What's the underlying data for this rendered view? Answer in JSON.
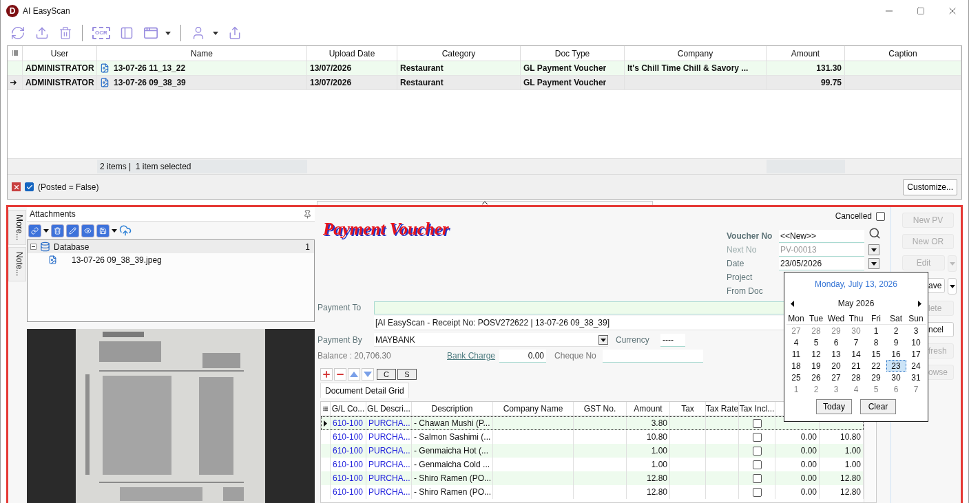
{
  "window": {
    "logo": "D",
    "title": "AI EasyScan"
  },
  "toolbar": {
    "ocr_label": "OCR"
  },
  "list": {
    "columns": [
      "User",
      "Name",
      "Upload Date",
      "Category",
      "Doc Type",
      "Company",
      "Amount",
      "Caption"
    ],
    "rows": [
      {
        "user": "ADMINISTRATOR",
        "name": "13-07-26 11_13_22",
        "upload_date": "13/07/2026",
        "category": "Restaurant",
        "doc_type": "GL Payment Voucher",
        "company": "It's Chill Time Chill & Savory ...",
        "amount": "131.30",
        "selected": false
      },
      {
        "user": "ADMINISTRATOR",
        "name": "13-07-26 09_38_39",
        "upload_date": "13/07/2026",
        "category": "Restaurant",
        "doc_type": "GL Payment Voucher",
        "amount": "99.75",
        "selected": true
      }
    ],
    "footer": "2 items |  1 item selected"
  },
  "filter": {
    "active": true,
    "text": "(Posted = False)",
    "customize_button": "Customize..."
  },
  "side_tabs": [
    "More...",
    "Note..."
  ],
  "attachments": {
    "title": "Attachments",
    "tree": [
      {
        "label": "Database",
        "count": "1",
        "expanded": true,
        "children": [
          {
            "label": "13-07-26 09_38_39.jpeg"
          }
        ]
      }
    ]
  },
  "voucher": {
    "title": "Payment Voucher",
    "cancelled": {
      "label": "Cancelled",
      "checked": false
    },
    "fields": [
      {
        "label": "Voucher No",
        "value": "<<New>>",
        "kind": "search",
        "bold": true,
        "disabled": false
      },
      {
        "label": "Next No",
        "value": "PV-00013",
        "kind": "dropdown",
        "bold": false,
        "disabled": true
      },
      {
        "label": "Date",
        "value": "23/05/2026",
        "kind": "dropdown",
        "bold": false,
        "disabled": false
      },
      {
        "label": "Project",
        "kind": "covered",
        "bold": false,
        "disabled": false
      },
      {
        "label": "From Doc",
        "kind": "covered",
        "bold": false,
        "disabled": false
      }
    ],
    "payment_to": {
      "label": "Payment To",
      "remark": "[AI EasyScan - Receipt No: POSV272622 | 13-07-26 09_38_39]"
    },
    "payment_by": {
      "label": "Payment By",
      "value": "MAYBANK"
    },
    "currency": {
      "label": "Currency",
      "value": "----"
    },
    "balance": "Balance : 20,706.30",
    "bank_charge": {
      "label": "Bank Charge",
      "value": "0.00"
    },
    "cheque_no": {
      "label": "Cheque No"
    },
    "grid_buttons": [
      "C",
      "S"
    ],
    "grid_tab": "Document Detail Grid"
  },
  "detail": {
    "columns": [
      "G/L Co...",
      "GL Descri...",
      "Description",
      "Company Name",
      "GST No.",
      "Amount",
      "Tax",
      "Tax Rate",
      "Tax Incl..."
    ],
    "rows": [
      {
        "gl_code": "610-100",
        "gl_desc": "PURCHA...",
        "description": "- Chawan Mushi (P...",
        "amount": "3.80",
        "tax_inclusive": false,
        "selected": true
      },
      {
        "gl_code": "610-100",
        "gl_desc": "PURCHA...",
        "description": "- Salmon Sashimi (...",
        "amount": "10.80",
        "tax_inclusive": false,
        "column_10": "0.00",
        "column_11": "10.80",
        "selected": false
      },
      {
        "gl_code": "610-100",
        "gl_desc": "PURCHA...",
        "description": "- Genmaicha Hot (...",
        "amount": "1.00",
        "tax_inclusive": false,
        "column_10": "0.00",
        "column_11": "1.00",
        "selected": false
      },
      {
        "gl_code": "610-100",
        "gl_desc": "PURCHA...",
        "description": "- Genmaicha Cold ...",
        "amount": "1.00",
        "tax_inclusive": false,
        "column_10": "0.00",
        "column_11": "1.00",
        "selected": false
      },
      {
        "gl_code": "610-100",
        "gl_desc": "PURCHA...",
        "description": "- Shiro Ramen (PO...",
        "amount": "12.80",
        "tax_inclusive": false,
        "column_10": "0.00",
        "column_11": "12.80",
        "selected": false
      },
      {
        "gl_code": "610-100",
        "gl_desc": "PURCHA...",
        "description": "- Shiro Ramen (PO...",
        "amount": "12.80",
        "tax_inclusive": false,
        "column_10": "0.00",
        "column_11": "12.80",
        "selected": false
      }
    ]
  },
  "buttons": [
    {
      "label": "New PV",
      "disabled": true,
      "dropdown": false,
      "covered": false
    },
    {
      "label": "New OR",
      "disabled": true,
      "dropdown": false,
      "covered": false
    },
    {
      "label": "Edit",
      "disabled": true,
      "dropdown": true,
      "covered": false
    },
    {
      "label": "ave",
      "disabled": false,
      "dropdown": true,
      "covered": true
    },
    {
      "label": "lete",
      "disabled": true,
      "dropdown": false,
      "covered": true
    },
    {
      "label": "ncel",
      "disabled": false,
      "dropdown": false,
      "covered": true
    },
    {
      "label": "fresh",
      "disabled": true,
      "dropdown": false,
      "covered": true
    },
    {
      "label": "owse",
      "disabled": true,
      "dropdown": false,
      "covered": true
    }
  ],
  "calendar": {
    "caption": "Monday, July 13, 2026",
    "month": "May 2026",
    "weekdays": [
      "Mon",
      "Tue",
      "Wed",
      "Thu",
      "Fri",
      "Sat",
      "Sun"
    ],
    "days": [
      {
        "label": "27",
        "outside": true,
        "selected": false
      },
      {
        "label": "28",
        "outside": true,
        "selected": false
      },
      {
        "label": "29",
        "outside": true,
        "selected": false
      },
      {
        "label": "30",
        "outside": true,
        "selected": false
      },
      {
        "label": "1",
        "outside": false,
        "selected": false
      },
      {
        "label": "2",
        "outside": false,
        "selected": false
      },
      {
        "label": "3",
        "outside": false,
        "selected": false
      },
      {
        "label": "4",
        "outside": false,
        "selected": false
      },
      {
        "label": "5",
        "outside": false,
        "selected": false
      },
      {
        "label": "6",
        "outside": false,
        "selected": false
      },
      {
        "label": "7",
        "outside": false,
        "selected": false
      },
      {
        "label": "8",
        "outside": false,
        "selected": false
      },
      {
        "label": "9",
        "outside": false,
        "selected": false
      },
      {
        "label": "10",
        "outside": false,
        "selected": false
      },
      {
        "label": "11",
        "outside": false,
        "selected": false
      },
      {
        "label": "12",
        "outside": false,
        "selected": false
      },
      {
        "label": "13",
        "outside": false,
        "selected": false
      },
      {
        "label": "14",
        "outside": false,
        "selected": false
      },
      {
        "label": "15",
        "outside": false,
        "selected": false
      },
      {
        "label": "16",
        "outside": false,
        "selected": false
      },
      {
        "label": "17",
        "outside": false,
        "selected": false
      },
      {
        "label": "18",
        "outside": false,
        "selected": false
      },
      {
        "label": "19",
        "outside": false,
        "selected": false
      },
      {
        "label": "20",
        "outside": false,
        "selected": false
      },
      {
        "label": "21",
        "outside": false,
        "selected": false
      },
      {
        "label": "22",
        "outside": false,
        "selected": false
      },
      {
        "label": "23",
        "outside": false,
        "selected": true
      },
      {
        "label": "24",
        "outside": false,
        "selected": false
      },
      {
        "label": "25",
        "outside": false,
        "selected": false
      },
      {
        "label": "26",
        "outside": false,
        "selected": false
      },
      {
        "label": "27",
        "outside": false,
        "selected": false
      },
      {
        "label": "28",
        "outside": false,
        "selected": false
      },
      {
        "label": "29",
        "outside": false,
        "selected": false
      },
      {
        "label": "30",
        "outside": false,
        "selected": false
      },
      {
        "label": "31",
        "outside": false,
        "selected": false
      },
      {
        "label": "1",
        "outside": true,
        "selected": false
      },
      {
        "label": "2",
        "outside": true,
        "selected": false
      },
      {
        "label": "3",
        "outside": true,
        "selected": false
      },
      {
        "label": "4",
        "outside": true,
        "selected": false
      },
      {
        "label": "5",
        "outside": true,
        "selected": false
      },
      {
        "label": "6",
        "outside": true,
        "selected": false
      },
      {
        "label": "7",
        "outside": true,
        "selected": false
      }
    ],
    "buttons": [
      "Today",
      "Clear"
    ]
  }
}
